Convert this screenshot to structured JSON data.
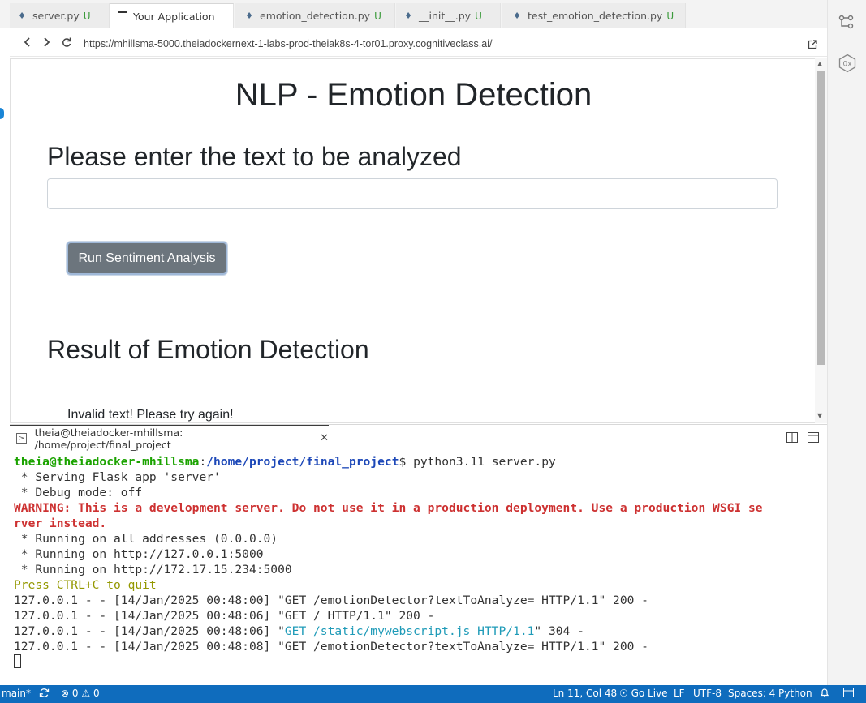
{
  "tabs": [
    {
      "label": "server.py",
      "status": "U",
      "icon": "python-icon",
      "active": false
    },
    {
      "label": "Your Application",
      "status": "",
      "icon": "browser-icon",
      "active": true
    },
    {
      "label": "emotion_detection.py",
      "status": "U",
      "icon": "python-icon",
      "active": false
    },
    {
      "label": "__init__.py",
      "status": "U",
      "icon": "python-icon",
      "active": false
    },
    {
      "label": "test_emotion_detection.py",
      "status": "U",
      "icon": "python-icon",
      "active": false
    }
  ],
  "browser": {
    "url": "https://mhillsma-5000.theiadockernext-1-labs-prod-theiak8s-4-tor01.proxy.cognitiveclass.ai/"
  },
  "page": {
    "title": "NLP - Emotion Detection",
    "prompt_heading": "Please enter the text to be analyzed",
    "input_value": "",
    "button_label": "Run Sentiment Analysis",
    "result_heading": "Result of Emotion Detection",
    "result_text": "Invalid text! Please try again!"
  },
  "terminal": {
    "tab_label": "theia@theiadocker-mhillsma: /home/project/final_project",
    "prompt_user": "theia@theiadocker-mhillsma",
    "prompt_sep": ":",
    "prompt_path": "/home/project/final_project",
    "prompt_dollar": "$ ",
    "command": "python3.11 server.py",
    "line_serving": " * Serving Flask app 'server'",
    "line_debug": " * Debug mode: off",
    "warning_1": "WARNING: This is a development server. Do not use it in a production deployment. Use a production WSGI se",
    "warning_2": "rver instead.",
    "line_all": " * Running on all addresses (0.0.0.0)",
    "line_local": " * Running on http://127.0.0.1:5000",
    "line_net": " * Running on http://172.17.15.234:5000",
    "line_quit": "Press CTRL+C to quit",
    "log_1": "127.0.0.1 - - [14/Jan/2025 00:48:00] \"GET /emotionDetector?textToAnalyze= HTTP/1.1\" 200 -",
    "log_2": "127.0.0.1 - - [14/Jan/2025 00:48:06] \"GET / HTTP/1.1\" 200 -",
    "log_3_pre": "127.0.0.1 - - [14/Jan/2025 00:48:06] \"",
    "log_3_mid": "GET /static/mywebscript.js HTTP/1.1",
    "log_3_post": "\" 304 -",
    "log_4": "127.0.0.1 - - [14/Jan/2025 00:48:08] \"GET /emotionDetector?textToAnalyze= HTTP/1.1\" 200 -"
  },
  "statusbar": {
    "branch": "main*",
    "errors": "0",
    "warnings": "0",
    "position": "Ln 11, Col 48",
    "go_live": "Go Live",
    "eol": "LF",
    "encoding": "UTF-8",
    "indent": "Spaces: 4",
    "language": "Python",
    "color": "#0f6cbd"
  }
}
